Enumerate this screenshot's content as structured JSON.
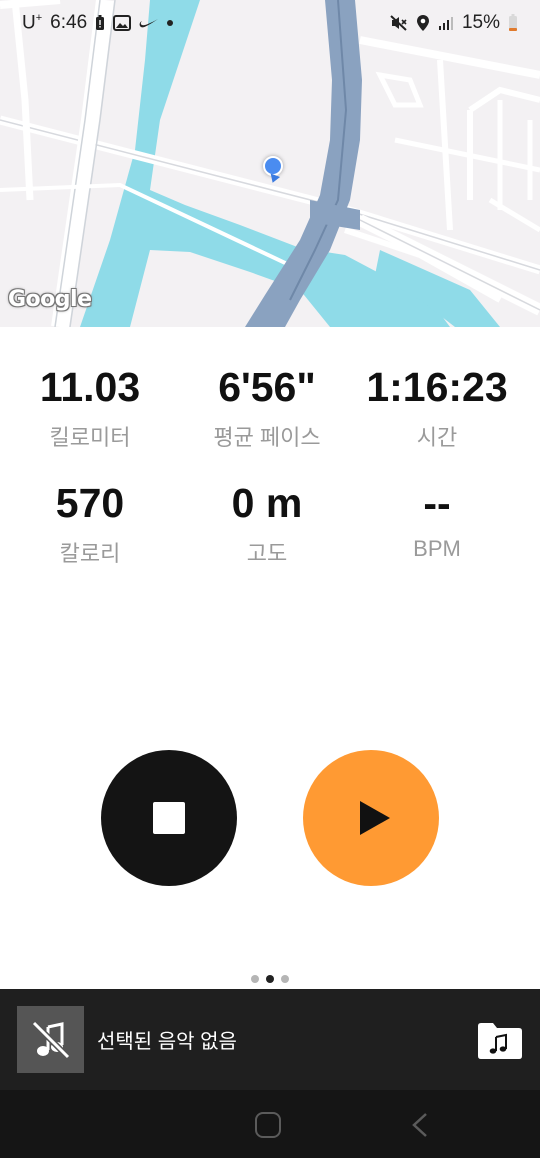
{
  "status_bar": {
    "carrier": "U",
    "carrier_sup": "+",
    "time": "6:46",
    "battery_percent": "15%"
  },
  "map": {
    "provider_logo": "Google"
  },
  "stats": [
    {
      "value": "11.03",
      "label": "킬로미터"
    },
    {
      "value": "6'56\"",
      "label": "평균 페이스"
    },
    {
      "value": "1:16:23",
      "label": "시간"
    },
    {
      "value": "570",
      "label": "칼로리"
    },
    {
      "value": "0 m",
      "label": "고도"
    },
    {
      "value": "--",
      "label": "BPM"
    }
  ],
  "controls": {
    "stop_icon": "stop-icon",
    "play_icon": "play-icon",
    "stop_color": "#141414",
    "play_color": "#ff9a33"
  },
  "pager": {
    "total": 3,
    "active_index": 1
  },
  "music": {
    "status_text": "선택된 음악 없음",
    "art_icon": "music-off-icon",
    "folder_icon": "music-folder-icon"
  },
  "nav": {
    "home_icon": "home-icon",
    "back_icon": "back-icon"
  }
}
